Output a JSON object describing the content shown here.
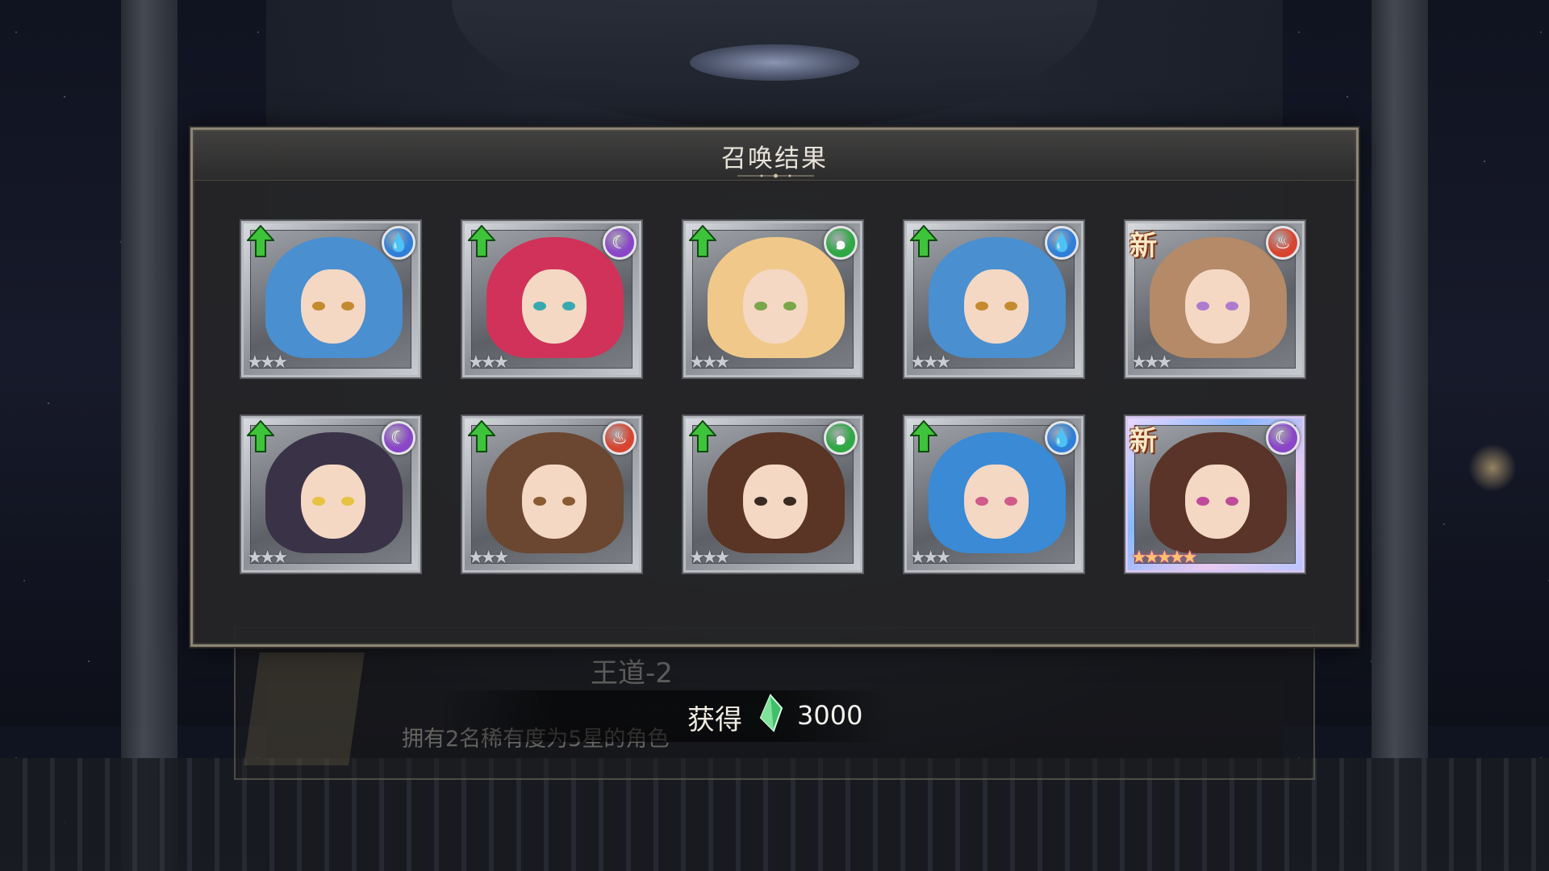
{
  "dialog": {
    "title": "召唤结果"
  },
  "results": [
    {
      "element": "water",
      "badge": "upgrade",
      "stars": "★★★",
      "hair": "#4a8fd0",
      "eyes": "#c48a30"
    },
    {
      "element": "dark",
      "badge": "upgrade",
      "stars": "★★★",
      "hair": "#d0325a",
      "eyes": "#39a9b0"
    },
    {
      "element": "wind",
      "badge": "upgrade",
      "stars": "★★★",
      "hair": "#f0c98a",
      "eyes": "#7aa64a"
    },
    {
      "element": "water",
      "badge": "upgrade",
      "stars": "★★★",
      "hair": "#4a8fd0",
      "eyes": "#c48a30"
    },
    {
      "element": "fire",
      "badge": "new",
      "badge_text": "新",
      "stars": "★★★",
      "hair": "#b58a68",
      "eyes": "#b07ad0"
    },
    {
      "element": "dark",
      "badge": "upgrade",
      "stars": "★★★",
      "hair": "#3a3348",
      "eyes": "#e6c240"
    },
    {
      "element": "fire",
      "badge": "upgrade",
      "stars": "★★★",
      "hair": "#6b4631",
      "eyes": "#8a5a32"
    },
    {
      "element": "wind",
      "badge": "upgrade",
      "stars": "★★★",
      "hair": "#5a3424",
      "eyes": "#3a2a22"
    },
    {
      "element": "water",
      "badge": "upgrade",
      "stars": "★★★",
      "hair": "#3a8ad6",
      "eyes": "#d05a8a"
    },
    {
      "element": "dark",
      "badge": "new",
      "badge_text": "新",
      "stars": "★★★★★",
      "hair": "#5a3428",
      "eyes": "#c04a9a"
    }
  ],
  "elements": {
    "water": {
      "color": "#2f7fd8",
      "glyph": "💧"
    },
    "dark": {
      "color": "#8a45c8",
      "glyph": "☾"
    },
    "wind": {
      "color": "#2fa845",
      "glyph": "๑"
    },
    "fire": {
      "color": "#d8452f",
      "glyph": "♨"
    }
  },
  "achievement": {
    "name": "王道-2",
    "description": "拥有2名稀有度为5星的角色"
  },
  "reward": {
    "label": "获得",
    "amount": "3000",
    "icon": "green-crystal-icon"
  }
}
